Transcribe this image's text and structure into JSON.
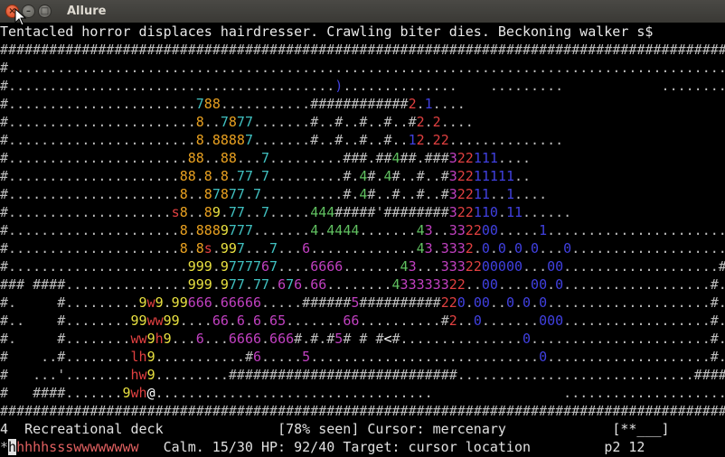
{
  "window": {
    "title": "Allure",
    "buttons": {
      "close": "×",
      "minimize": "–",
      "maximize": "□"
    }
  },
  "message_line": "Tentacled horror displaces hairdresser. Crawling biter dies. Beckoning walker s$",
  "map_rows": [
    "#####################################################################################################",
    "#.................................................................................................. ",
    "#........................................)..............    .........            ...............  .",
    "#.......................788...........############2.1....                                        ",
    "#.......................8..7877.......#..#..#..#..#2.2....                                       ",
    "#.......................8.88887.......#..#..#..#..12.22..............                            ",
    "#......................88..88...7.........###.##4##.###322111....                                ",
    "#.....................88.8.8.77.7.........#.4#.4#..#..#32211111..                                ",
    "#.....................8..87877.7..........#.4#..#..#..#32211..1....                              ",
    "#....................s8..89.77..7.....444#####'########322110.11......                   ......  ",
    "#.....................8.8889777.......4.4444.......43..332200.....1..............................",
    "#.....................8.8s.997...7...6.............43.3332.0.0.0.0...0...........................",
    "#......................999.9777767....6666.......43...3332200000...00...................######..",
    "### ####...............999.977.77.676.66........433333322..00....00.0..................#....#..",
    "#.     #.........9w9.99666.66666.....######5##########220.00..0.0.0....................#....#..",
    "#..    #........99ww99....66.6.6.65.......66..........#2..0.......000..................#....#..",
    "#.     #........ww9h9...6...6666.666#.#.#5# # #<#...............0......................#....#..",
    "#    ..#........lh9...........#6.....5............................0....................#....#..",
    "#   ...'........hw9.........############################.............................######..",
    "#   ####.......9wh@..................................                ...........................",
    "#####################################################################################################"
  ],
  "status_bar_1": {
    "level": "4",
    "level_name": "Recreational deck",
    "seen": "[78% seen]",
    "cursor_label": "Cursor: mercenary",
    "right": "[**___]"
  },
  "status_bar_2": {
    "star": "*",
    "party_selected": "h",
    "party_rest": "hhhhssswwwwwwww",
    "calm": "Calm. 15/30",
    "hp": "HP: 92/40",
    "target": "Target: cursor location",
    "page": "p2 12"
  },
  "colors": {
    "wall": "#bdbdbd",
    "floor": "#bdbdbd",
    "orange": "#e8a020",
    "yellow": "#e8e040",
    "magenta": "#c040c0",
    "green": "#60c060",
    "blue": "#4040e0",
    "cyan": "#40c0c0",
    "red": "#e04040",
    "white": "#ffffff"
  }
}
